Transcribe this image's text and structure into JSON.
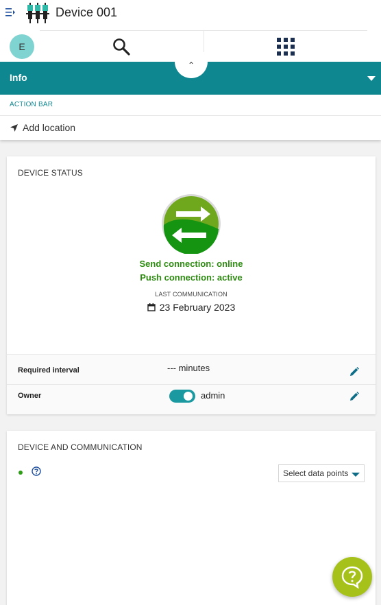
{
  "header": {
    "title": "Device 001",
    "avatar_initial": "E"
  },
  "info_bar": {
    "title": "Info"
  },
  "action_bar": {
    "label": "ACTION BAR",
    "add_location": "Add location"
  },
  "device_status": {
    "title": "DEVICE STATUS",
    "send_connection": "Send connection: online",
    "push_connection": "Push connection: active",
    "last_communication_label": "LAST COMMUNICATION",
    "last_communication_date": "23 February 2023",
    "required_interval_label": "Required interval",
    "required_interval_value": "--- minutes",
    "owner_label": "Owner",
    "owner_value": "admin"
  },
  "device_communication": {
    "title": "DEVICE AND COMMUNICATION",
    "select_placeholder": "Select data points"
  },
  "colors": {
    "accent": "#0f8790",
    "online": "#2e8b12",
    "help_fab": "#a6c11a",
    "avatar": "#7fd3d1"
  },
  "icons": {
    "menu": "menu-icon",
    "device": "device-icon",
    "search": "search-icon",
    "apps": "apps-grid-icon",
    "location": "location-arrow-icon",
    "calendar": "calendar-icon",
    "edit": "pencil-icon",
    "help": "help-icon"
  }
}
